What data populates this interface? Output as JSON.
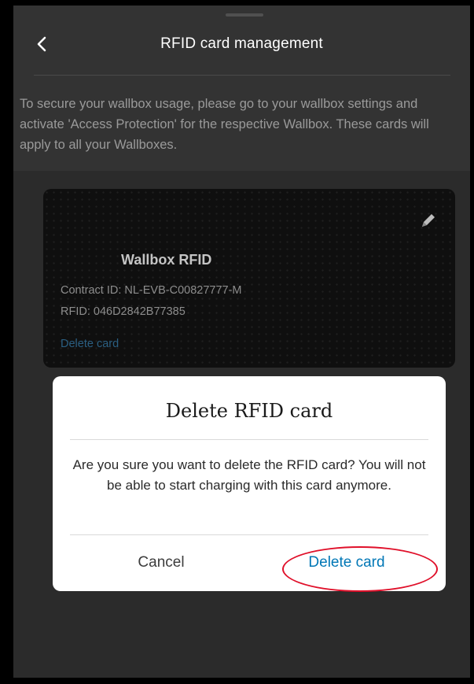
{
  "header": {
    "title": "RFID card management",
    "back_icon": "chevron-left-icon"
  },
  "info_text": "To secure your wallbox usage, please go to your wallbox settings and activate 'Access Protection' for the respective Wallbox. These cards will apply to all your Wallboxes.",
  "card": {
    "title": "Wallbox RFID",
    "contract_id": "Contract ID: NL-EVB-C00827777-M",
    "rfid": "RFID: 046D2842B77385",
    "delete_link": "Delete card",
    "edit_icon": "pencil-icon"
  },
  "modal": {
    "title": "Delete RFID card",
    "body": "Are you sure you want to delete the RFID card? You will not be able to start charging with this card anymore.",
    "cancel_label": "Cancel",
    "delete_label": "Delete card"
  },
  "colors": {
    "accent": "#0077b6",
    "highlight": "#e0102a",
    "card_background": "#0f0f0f",
    "dimmed_background": "#333333"
  }
}
